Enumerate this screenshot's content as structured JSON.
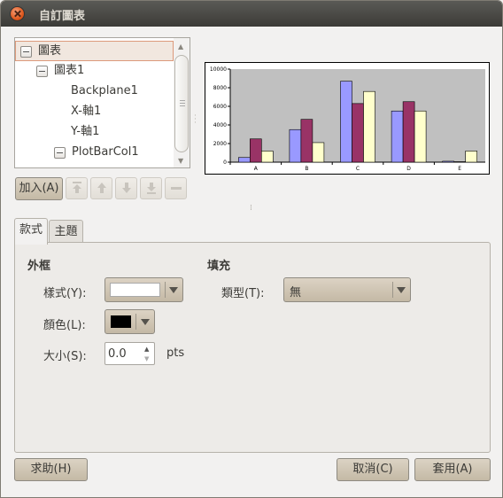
{
  "window": {
    "title": "自訂圖表"
  },
  "tree": {
    "items": [
      {
        "label": "圖表",
        "expander": true
      },
      {
        "label": "圖表1",
        "expander": true
      },
      {
        "label": "Backplane1",
        "expander": false
      },
      {
        "label": "X-軸1",
        "expander": false
      },
      {
        "label": "Y-軸1",
        "expander": false
      },
      {
        "label": "PlotBarCol1",
        "expander": true
      }
    ],
    "selected_index": 0
  },
  "toolbar": {
    "add_label": "加入(A)",
    "icons": [
      "move-top-icon",
      "move-up-icon",
      "move-down-icon",
      "move-bottom-icon",
      "remove-icon"
    ]
  },
  "tabs": [
    {
      "label": "款式"
    },
    {
      "label": "主題"
    }
  ],
  "style_panel": {
    "border_title": "外框",
    "style_label": "樣式(Y):",
    "color_label": "顏色(L):",
    "size_label": "大小(S):",
    "size_value": "0.0",
    "size_unit": "pts",
    "fill_title": "填充",
    "type_label": "類型(T):",
    "type_value": "無",
    "border_color": "#000000",
    "border_style_color": "#ffffff"
  },
  "footer": {
    "help_label": "求助(H)",
    "cancel_label": "取消(C)",
    "apply_label": "套用(A)"
  },
  "chart_data": {
    "type": "bar",
    "categories": [
      "A",
      "B",
      "C",
      "D",
      "E"
    ],
    "ylim": [
      0,
      10000
    ],
    "yticks": [
      "0",
      "2000",
      "4000",
      "6000",
      "8000",
      "10000"
    ],
    "series": [
      {
        "values": [
          500,
          3500,
          8700,
          5500,
          100
        ],
        "color": "#9999ff"
      },
      {
        "values": [
          2500,
          4600,
          6300,
          6500,
          50
        ],
        "color": "#993366"
      },
      {
        "values": [
          1200,
          2100,
          7600,
          5500,
          1200
        ],
        "color": "#ffffcc"
      }
    ],
    "plot_background": "#c0c0c0"
  }
}
